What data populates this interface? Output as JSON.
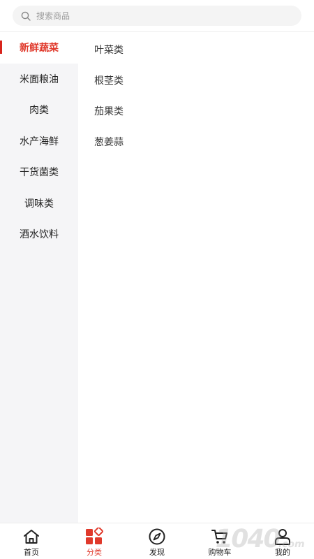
{
  "search": {
    "placeholder": "搜索商品",
    "icon": "search-icon"
  },
  "sidebar": {
    "items": [
      {
        "label": "新鲜蔬菜",
        "active": true
      },
      {
        "label": "米面粮油"
      },
      {
        "label": "肉类"
      },
      {
        "label": "水产海鲜"
      },
      {
        "label": "干货菌类"
      },
      {
        "label": "调味类"
      },
      {
        "label": "酒水饮料"
      }
    ]
  },
  "subcategories": [
    {
      "label": "叶菜类"
    },
    {
      "label": "根茎类"
    },
    {
      "label": "茄果类"
    },
    {
      "label": "葱姜蒜"
    }
  ],
  "tabbar": {
    "items": [
      {
        "label": "首页",
        "icon": "home-icon"
      },
      {
        "label": "分类",
        "icon": "category-icon",
        "active": true
      },
      {
        "label": "发现",
        "icon": "compass-icon"
      },
      {
        "label": "购物车",
        "icon": "cart-icon"
      },
      {
        "label": "我的",
        "icon": "profile-icon"
      }
    ]
  },
  "watermark": {
    "text": "1040",
    "suffix": ".com"
  },
  "colors": {
    "accent": "#e0392b",
    "sidebar_bg": "#f5f5f7",
    "search_bg": "#f4f4f4"
  }
}
